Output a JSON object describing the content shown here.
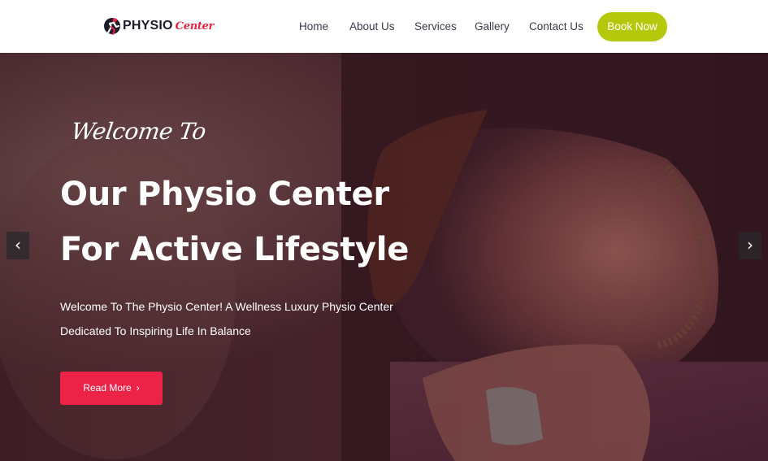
{
  "header": {
    "logo_word": "PHYSIO",
    "logo_script": "Center",
    "nav": [
      {
        "label": "Home"
      },
      {
        "label": "About Us"
      },
      {
        "label": "Services"
      },
      {
        "label": "Gallery"
      },
      {
        "label": "Contact Us"
      }
    ],
    "book_label": "Book Now"
  },
  "hero": {
    "welcome": "Welcome To",
    "title_line1": "Our Physio Center",
    "title_line2": "For Active Lifestyle",
    "desc_line1": "Welcome To The Physio Center! A Wellness Luxury Physio Center",
    "desc_line2": "Dedicated To Inspiring Life In Balance",
    "read_more": "Read More",
    "read_more_icon": "chevron-right-icon",
    "prev_icon": "chevron-left-icon",
    "next_icon": "chevron-right-icon"
  },
  "colors": {
    "brand_red": "#ec2347",
    "brand_green": "#b6c80c",
    "nav_text": "#3b3b4a"
  }
}
